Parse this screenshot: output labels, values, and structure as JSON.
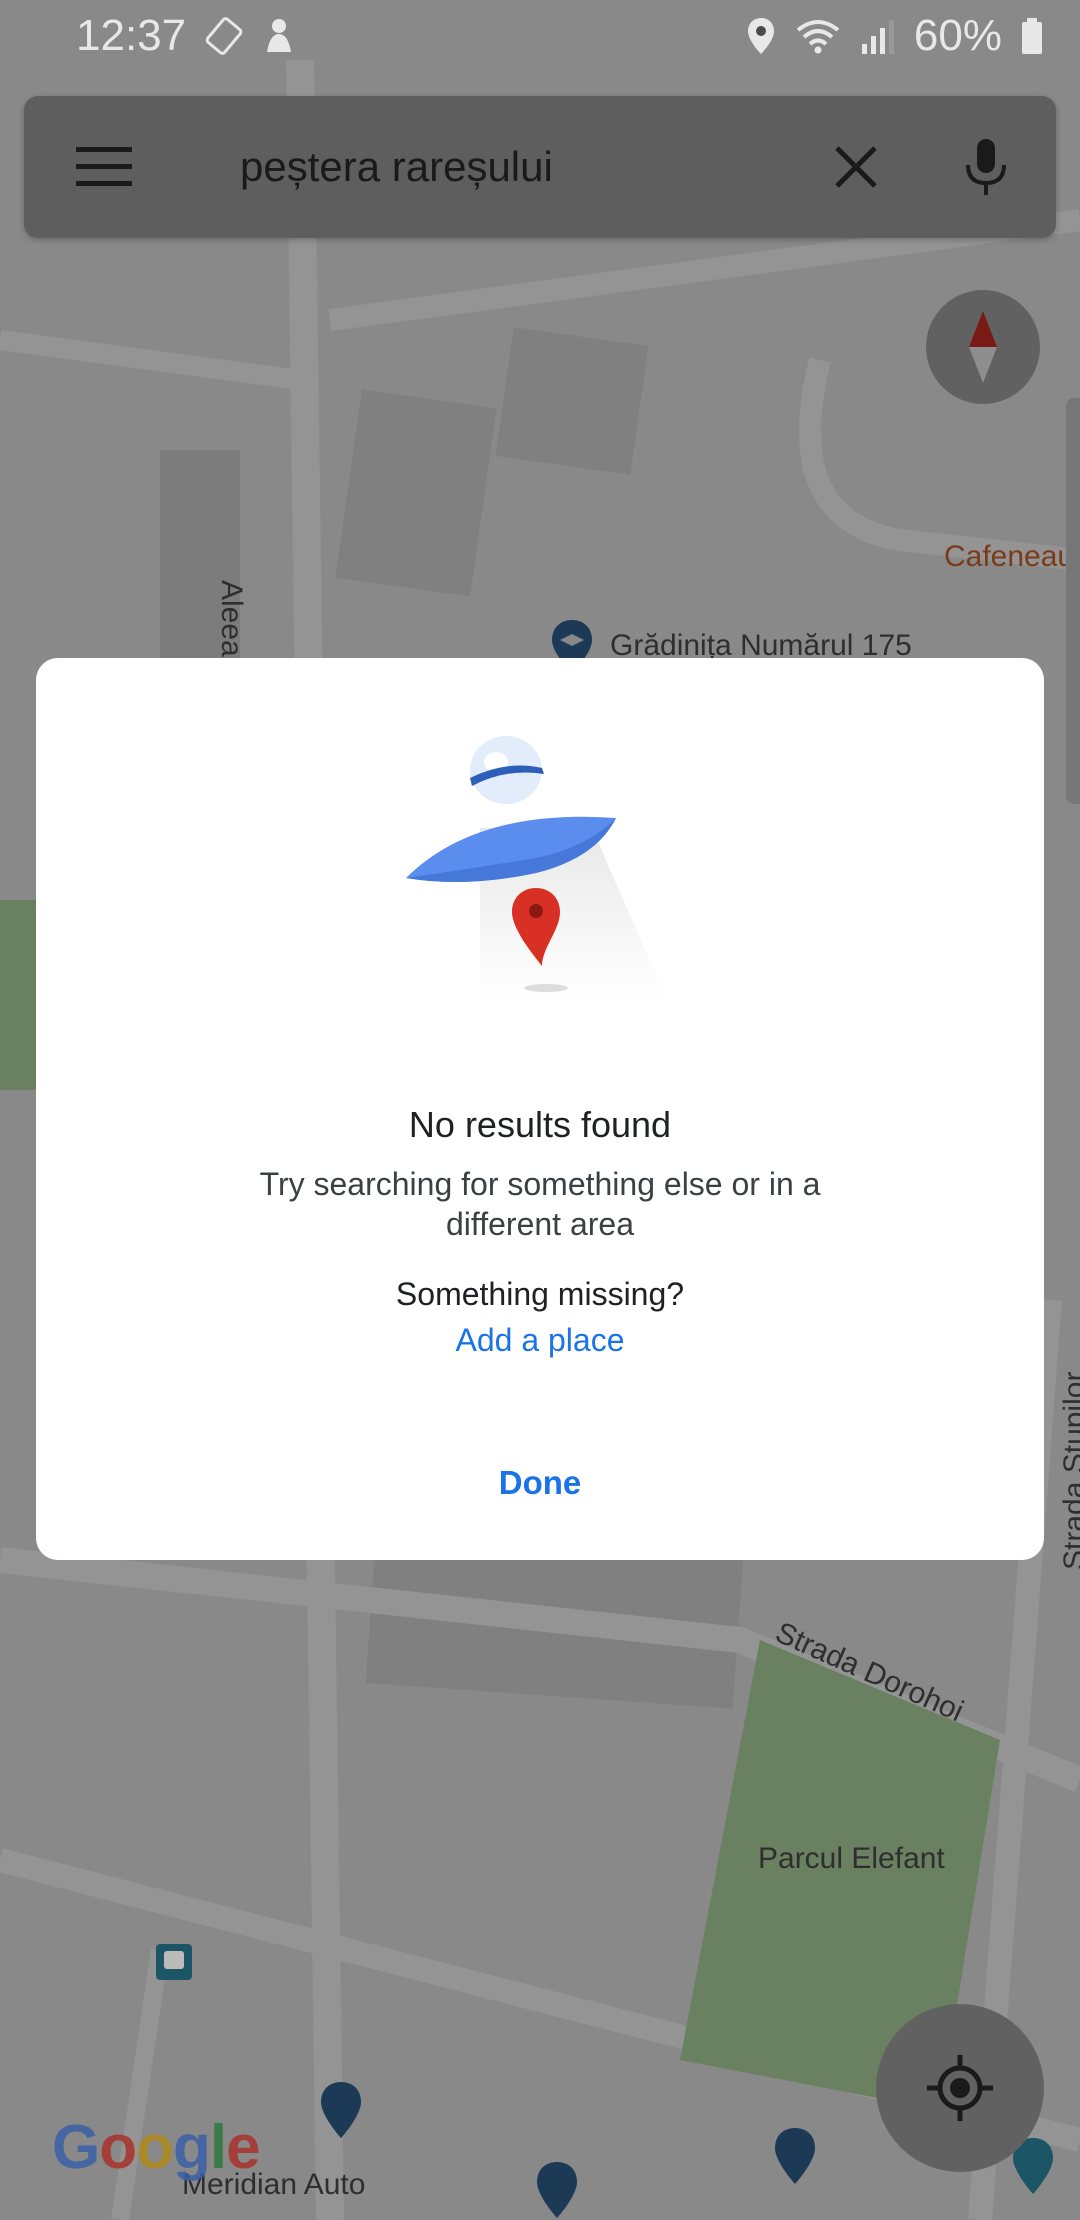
{
  "status_bar": {
    "time": "12:37",
    "battery": "60%"
  },
  "search": {
    "query": "peștera rareșului"
  },
  "map_labels": {
    "aleea_top": "Aleea Dor",
    "aleea_side": "Aleea Doro",
    "cafe": "Cafeneau",
    "kindergarten": "Grădinița Numărul 175",
    "strada_stupilor": "Strada Stupilor",
    "strada_dorohoi": "Strada Dorohoi",
    "park": "Parcul Elefant",
    "meridian": "Meridian Auto"
  },
  "dialog": {
    "title": "No results found",
    "subtitle": "Try searching for something else or in a different area",
    "missing": "Something missing?",
    "add_place": "Add a place",
    "done": "Done"
  },
  "logo": "Google",
  "colors": {
    "accent": "#1a73e8",
    "pin_red": "#d93025",
    "ufo_blue": "#5b8def"
  }
}
